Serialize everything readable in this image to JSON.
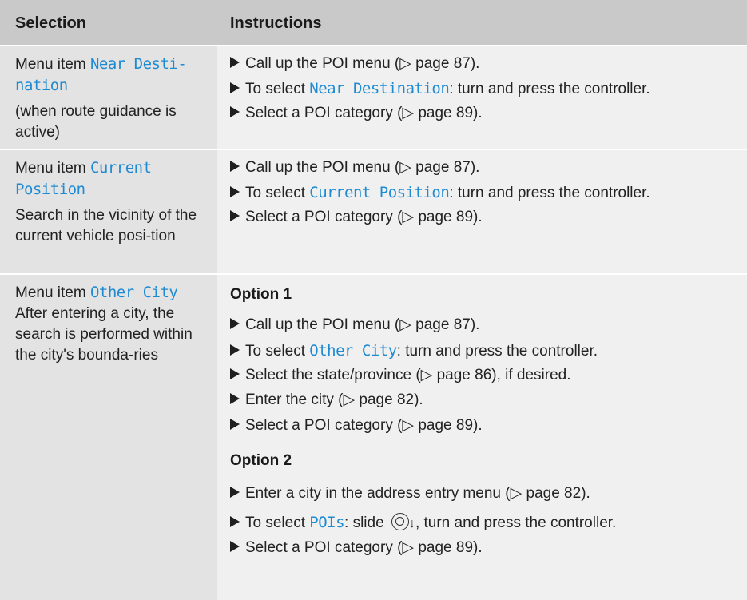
{
  "header": {
    "selection": "Selection",
    "instructions": "Instructions"
  },
  "rows": [
    {
      "left": {
        "prefix": "Menu item ",
        "mono1": "Near Desti-",
        "mono2": "nation",
        "desc": "(when route guidance is active)"
      },
      "items": [
        {
          "pre": "Call up the POI menu (",
          "arrow": "▷",
          "post": " page 87)."
        },
        {
          "pre": "To select ",
          "mono": "Near Destination",
          "post": ": turn and press the controller."
        },
        {
          "pre": "Select a POI category (",
          "arrow": "▷",
          "post": " page 89)."
        }
      ]
    },
    {
      "left": {
        "prefix": "Menu item ",
        "mono1": "Current",
        "mono2": "Position",
        "desc": "Search in the vicinity of the current vehicle posi-tion"
      },
      "items": [
        {
          "pre": "Call up the POI menu (",
          "arrow": "▷",
          "post": " page 87)."
        },
        {
          "pre": "To select ",
          "mono": "Current Position",
          "post": ": turn and press the controller."
        },
        {
          "pre": "Select a POI category (",
          "arrow": "▷",
          "post": " page 89)."
        }
      ]
    },
    {
      "left": {
        "prefix": "Menu item ",
        "mono1": "Other City",
        "desc": "After entering a city, the search is performed within the city's bounda-ries"
      },
      "option1": "Option 1",
      "items1": [
        {
          "pre": "Call up the POI menu (",
          "arrow": "▷",
          "post": " page 87)."
        },
        {
          "pre": "To select ",
          "mono": "Other City",
          "post": ": turn and press the controller."
        },
        {
          "pre": "Select the state/province (",
          "arrow": "▷",
          "post": " page 86), if desired."
        },
        {
          "pre": "Enter the city (",
          "arrow": "▷",
          "post": " page 82)."
        },
        {
          "pre": "Select a POI category (",
          "arrow": "▷",
          "post": " page 89)."
        }
      ],
      "option2": "Option 2",
      "items2": [
        {
          "pre": "Enter a city in the address entry menu (",
          "arrow": "▷",
          "post": " page 82)."
        },
        {
          "pre": "To select ",
          "mono": "POIs",
          "post": ": slide ",
          "icon": "controller-slide-down-icon",
          "post2": ", turn and press the controller."
        },
        {
          "pre": "Select a POI category (",
          "arrow": "▷",
          "post": " page 89)."
        }
      ]
    }
  ]
}
